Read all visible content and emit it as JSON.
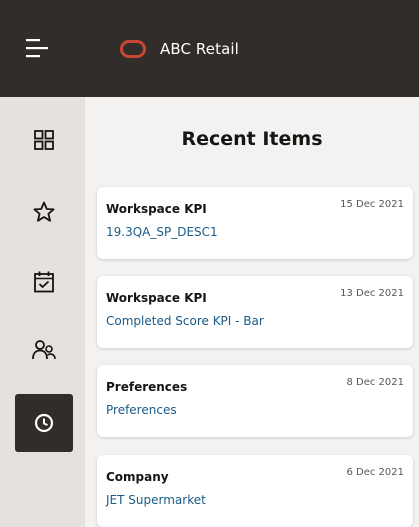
{
  "app": {
    "title": "ABC Retail",
    "menu_icon": "hamburger-menu-icon",
    "logo_icon": "oracle-logo-icon",
    "brand_color": "#c74634",
    "header_color": "#312d2a"
  },
  "nav": {
    "items": [
      {
        "icon": "grid-icon",
        "active": false
      },
      {
        "icon": "star-icon",
        "active": false
      },
      {
        "icon": "calendar-check-icon",
        "active": false
      },
      {
        "icon": "people-icon",
        "active": false
      },
      {
        "icon": "clock-icon",
        "active": true
      }
    ]
  },
  "panel": {
    "title": "Recent Items"
  },
  "recent_items": [
    {
      "type": "Workspace KPI",
      "date": "15 Dec 2021",
      "name": "19.3QA_SP_DESC1"
    },
    {
      "type": "Workspace KPI",
      "date": "13 Dec 2021",
      "name": "Completed Score KPI - Bar"
    },
    {
      "type": "Preferences",
      "date": "8 Dec 2021",
      "name": "Preferences"
    },
    {
      "type": "Company",
      "date": "6 Dec 2021",
      "name": "JET Supermarket"
    }
  ]
}
